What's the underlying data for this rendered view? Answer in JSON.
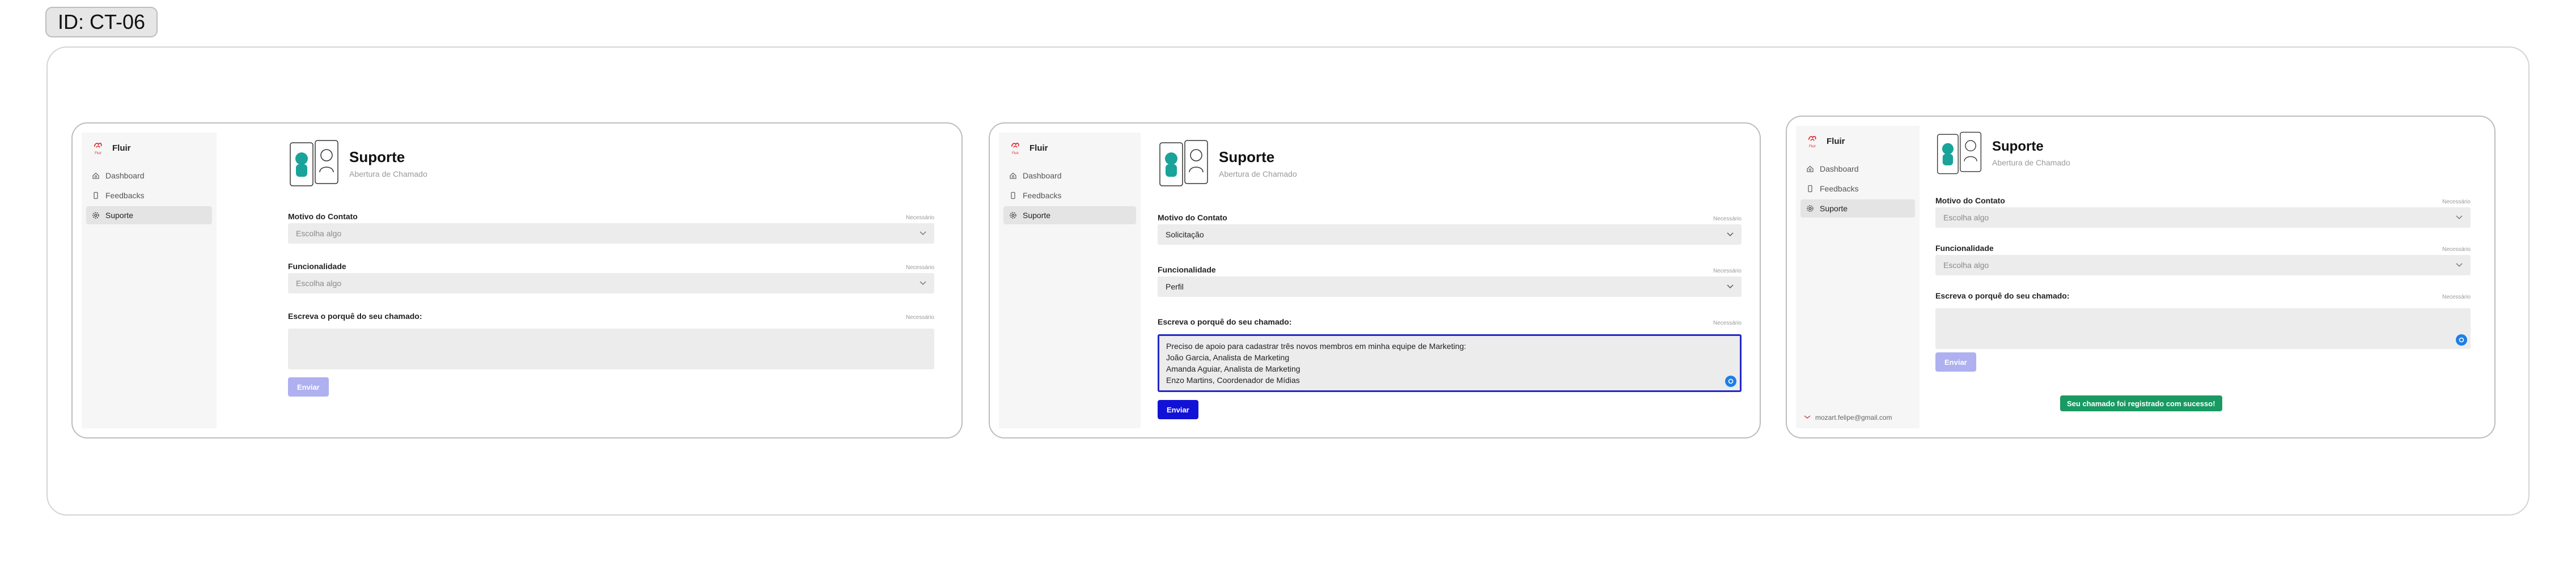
{
  "id_badge": "ID: CT-06",
  "app": {
    "logo_caption": "Fluir",
    "name": "Fluir",
    "nav": [
      {
        "label": "Dashboard",
        "icon": "home-icon"
      },
      {
        "label": "Feedbacks",
        "icon": "phone-icon"
      },
      {
        "label": "Suporte",
        "icon": "gear-icon"
      }
    ],
    "user_email": "mozart.felipe@gmail.com"
  },
  "page": {
    "title": "Suporte",
    "subtitle": "Abertura de Chamado",
    "required_label": "Necessário",
    "field1_label": "Motivo do Contato",
    "field2_label": "Funcionalidade",
    "field3_label": "Escreva o porquê do seu chamado:",
    "placeholder": "Escolha algo",
    "submit_label": "Enviar"
  },
  "screens": [
    {
      "state": "empty",
      "motivo_value": "Escolha algo",
      "funcionalidade_value": "Escolha algo",
      "submit_enabled": false
    },
    {
      "state": "filled",
      "motivo_value": "Solicitação",
      "funcionalidade_value": "Perfil",
      "message_lines": [
        "Preciso de apoio para cadastrar três novos membros em minha equipe de Marketing:",
        "João Garcia, Analista de Marketing",
        "Amanda Aguiar, Analista de Marketing",
        "Enzo Martins, Coordenador de Mídias"
      ],
      "submit_enabled": true
    },
    {
      "state": "submitted",
      "motivo_value": "Escolha algo",
      "funcionalidade_value": "Escolha algo",
      "submit_enabled": false,
      "toast": "Seu chamado foi registrado com sucesso!"
    }
  ],
  "colors": {
    "primary": "#1212d6",
    "primary_disabled": "#aeb0ef",
    "success": "#1a9a63",
    "focus_border": "#2227c8",
    "logo_red": "#e0282e",
    "illustration_teal": "#1aa39a"
  }
}
